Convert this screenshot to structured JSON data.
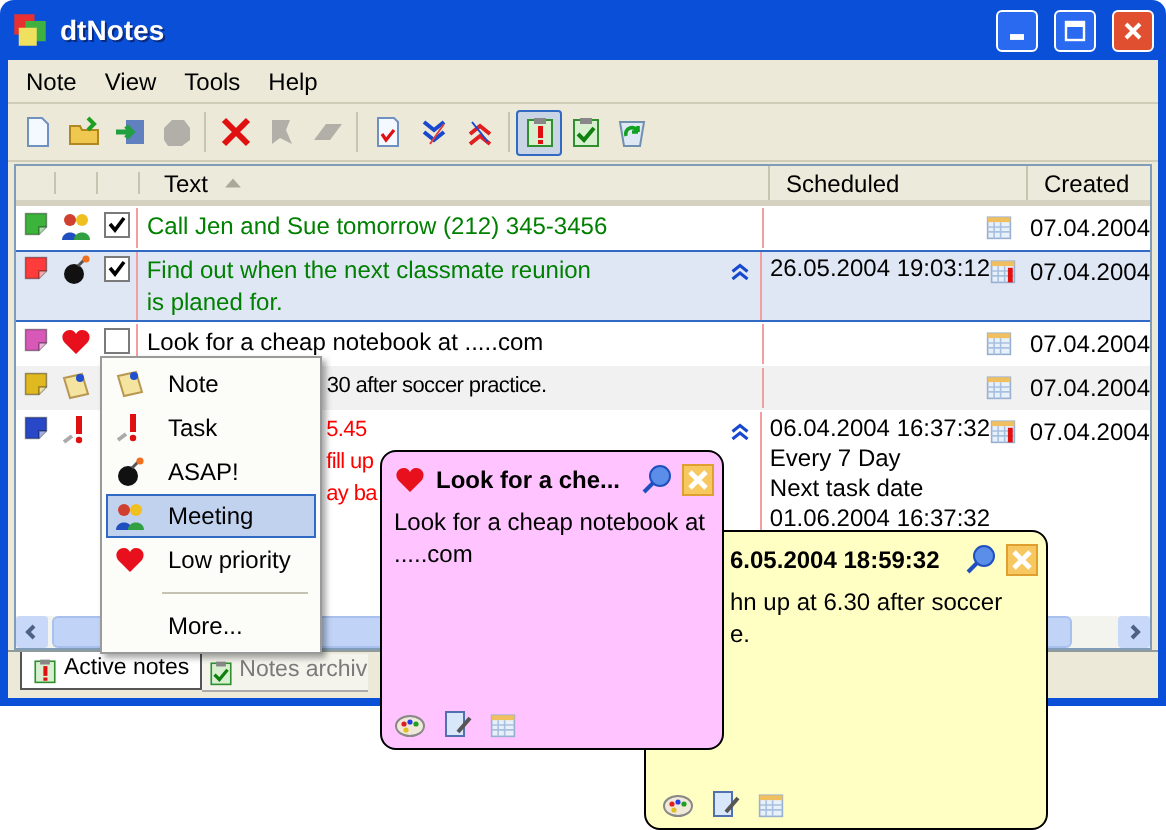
{
  "window": {
    "title": "dtNotes"
  },
  "menu_bar": [
    "Note",
    "View",
    "Tools",
    "Help"
  ],
  "toolbar": [
    {
      "kind": "new",
      "disabled": false,
      "pressed": false
    },
    {
      "kind": "open",
      "disabled": false,
      "pressed": false
    },
    {
      "kind": "import",
      "disabled": false,
      "pressed": false
    },
    {
      "kind": "tag",
      "disabled": true,
      "pressed": false
    },
    {
      "kind": "delete",
      "disabled": false,
      "pressed": false
    },
    {
      "kind": "arrow",
      "disabled": true,
      "pressed": false
    },
    {
      "kind": "eraser",
      "disabled": true,
      "pressed": false
    },
    {
      "kind": "check_page",
      "disabled": false,
      "pressed": false
    },
    {
      "kind": "priority_down",
      "disabled": false,
      "pressed": false
    },
    {
      "kind": "priority_up",
      "disabled": false,
      "pressed": false
    },
    {
      "kind": "active",
      "disabled": false,
      "pressed": true
    },
    {
      "kind": "archive",
      "disabled": false,
      "pressed": false
    },
    {
      "kind": "recycle",
      "disabled": false,
      "pressed": false
    }
  ],
  "table": {
    "columns": [
      {
        "label": "Text",
        "sorted": true
      },
      {
        "label": "Scheduled",
        "sorted": false
      },
      {
        "label": "Created",
        "sorted": false
      }
    ],
    "rows": [
      {
        "color": "#3cb43c",
        "kind": "meeting",
        "checked": true,
        "text": {
          "lines": [
            "Call Jen and Sue tomorrow (212) 345-3456"
          ],
          "color": "#008000"
        },
        "high_priority": false,
        "reminder": false,
        "created": "07.04.2004",
        "selected": false
      },
      {
        "color": "#ff3c3c",
        "kind": "asap",
        "checked": true,
        "text": {
          "lines": [
            "Find out when the next classmate reunion",
            "is planed for."
          ],
          "color": "#008000"
        },
        "high_priority": true,
        "scheduled": [
          "26.05.2004 19:03:12"
        ],
        "reminder": true,
        "created": "07.04.2004",
        "selected": true
      },
      {
        "color": "#d858b8",
        "kind": "low_priority",
        "checked": false,
        "text": {
          "lines": [
            "Look for a cheap notebook at  .....com"
          ],
          "color": "#000000"
        },
        "high_priority": false,
        "reminder": false,
        "created": "07.04.2004",
        "selected": false
      },
      {
        "color": "#e0b820",
        "kind": "note",
        "text": {
          "lines": [
            "30 after soccer practice."
          ],
          "color": "#000000"
        },
        "high_priority": false,
        "reminder": false,
        "created": "07.04.2004",
        "selected": false
      },
      {
        "color": "#2848c8",
        "kind": "task",
        "text": {
          "lines": [
            "5.45",
            "fill up",
            "ay ba"
          ],
          "color": "#ff0000"
        },
        "high_priority": true,
        "scheduled": [
          "06.04.2004 16:37:32",
          "Every 7 Day",
          "Next task date",
          "01.06.2004 16:37:32"
        ],
        "reminder": true,
        "created": "07.04.2004",
        "selected": false
      }
    ]
  },
  "tabs": [
    {
      "label": "Active notes",
      "kind": "active",
      "selected": true
    },
    {
      "label": "Notes archiv",
      "kind": "archive",
      "selected": false
    }
  ],
  "context_menu": {
    "items": [
      {
        "label": "Note",
        "kind": "note",
        "selected": false
      },
      {
        "label": "Task",
        "kind": "task",
        "selected": false
      },
      {
        "label": "ASAP!",
        "kind": "asap",
        "selected": false
      },
      {
        "label": "Meeting",
        "kind": "meeting",
        "selected": true
      },
      {
        "label": "Low priority",
        "kind": "low_priority",
        "selected": false
      },
      {
        "label": "More...",
        "kind": "more",
        "selected": false
      }
    ]
  },
  "sticky_notes": [
    {
      "title": "6.05.2004 18:59:32",
      "body": [
        "hn up at 6.30 after soccer",
        "e."
      ],
      "color": "#ffffc4"
    },
    {
      "title": "Look for a che...",
      "kind": "low_priority",
      "body": [
        "Look for a cheap notebook at",
        ".....com"
      ],
      "color": "#ffc4ff"
    }
  ]
}
